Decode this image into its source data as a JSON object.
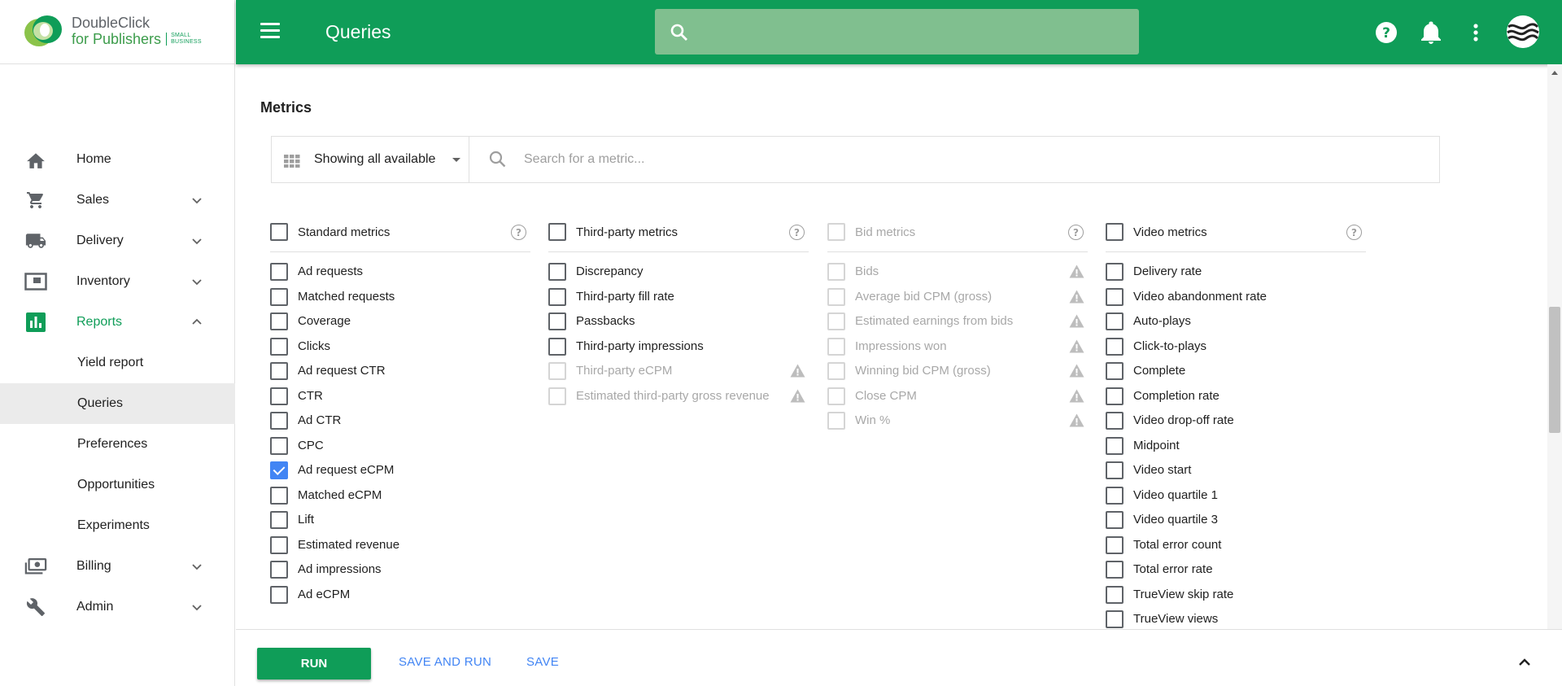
{
  "app": {
    "logo_line1": "DoubleClick",
    "logo_line2": "for Publishers",
    "logo_badge_line1": "SMALL",
    "logo_badge_line2": "BUSINESS",
    "brand_color": "#0f9d58"
  },
  "header": {
    "title": "Queries",
    "search_placeholder": "",
    "icons": [
      "menu-icon",
      "search-icon",
      "help-icon",
      "notifications-icon",
      "more-vert-icon",
      "avatar"
    ]
  },
  "sidebar": {
    "items": [
      {
        "label": "Home",
        "icon": "home-icon"
      },
      {
        "label": "Sales",
        "icon": "cart-icon",
        "expandable": true
      },
      {
        "label": "Delivery",
        "icon": "truck-icon",
        "expandable": true
      },
      {
        "label": "Inventory",
        "icon": "inventory-icon",
        "expandable": true
      },
      {
        "label": "Reports",
        "icon": "bar-chart-icon",
        "expanded": true,
        "active": true
      },
      {
        "label": "Billing",
        "icon": "money-icon",
        "expandable": true
      },
      {
        "label": "Admin",
        "icon": "wrench-icon",
        "expandable": true
      }
    ],
    "reports_sub": [
      {
        "label": "Yield report"
      },
      {
        "label": "Queries",
        "selected": true
      },
      {
        "label": "Preferences"
      },
      {
        "label": "Opportunities"
      },
      {
        "label": "Experiments"
      }
    ]
  },
  "metrics": {
    "title": "Metrics",
    "filter_label": "Showing all available",
    "search_placeholder": "Search for a metric...",
    "columns": [
      {
        "heading": "Standard metrics",
        "disabled": false,
        "items": [
          {
            "label": "Ad requests",
            "checked": false
          },
          {
            "label": "Matched requests",
            "checked": false
          },
          {
            "label": "Coverage",
            "checked": false
          },
          {
            "label": "Clicks",
            "checked": false
          },
          {
            "label": "Ad request CTR",
            "checked": false
          },
          {
            "label": "CTR",
            "checked": false
          },
          {
            "label": "Ad CTR",
            "checked": false
          },
          {
            "label": "CPC",
            "checked": false
          },
          {
            "label": "Ad request eCPM",
            "checked": true
          },
          {
            "label": "Matched eCPM",
            "checked": false
          },
          {
            "label": "Lift",
            "checked": false
          },
          {
            "label": "Estimated revenue",
            "checked": false
          },
          {
            "label": "Ad impressions",
            "checked": false
          },
          {
            "label": "Ad eCPM",
            "checked": false
          }
        ]
      },
      {
        "heading": "Third-party metrics",
        "disabled": false,
        "items": [
          {
            "label": "Discrepancy",
            "checked": false
          },
          {
            "label": "Third-party fill rate",
            "checked": false
          },
          {
            "label": "Passbacks",
            "checked": false
          },
          {
            "label": "Third-party impressions",
            "checked": false
          },
          {
            "label": "Third-party eCPM",
            "checked": false,
            "disabled": true,
            "warning": true
          },
          {
            "label": "Estimated third-party gross revenue",
            "checked": false,
            "disabled": true,
            "warning": true
          }
        ]
      },
      {
        "heading": "Bid metrics",
        "disabled": true,
        "items": [
          {
            "label": "Bids",
            "disabled": true,
            "warning": true
          },
          {
            "label": "Average bid CPM (gross)",
            "disabled": true,
            "warning": true
          },
          {
            "label": "Estimated earnings from bids",
            "disabled": true,
            "warning": true
          },
          {
            "label": "Impressions won",
            "disabled": true,
            "warning": true
          },
          {
            "label": "Winning bid CPM (gross)",
            "disabled": true,
            "warning": true
          },
          {
            "label": "Close CPM",
            "disabled": true,
            "warning": true
          },
          {
            "label": "Win %",
            "disabled": true,
            "warning": true
          }
        ]
      },
      {
        "heading": "Video metrics",
        "disabled": false,
        "items": [
          {
            "label": "Delivery rate",
            "checked": false
          },
          {
            "label": "Video abandonment rate",
            "checked": false
          },
          {
            "label": "Auto-plays",
            "checked": false
          },
          {
            "label": "Click-to-plays",
            "checked": false
          },
          {
            "label": "Complete",
            "checked": false
          },
          {
            "label": "Completion rate",
            "checked": false
          },
          {
            "label": "Video drop-off rate",
            "checked": false
          },
          {
            "label": "Midpoint",
            "checked": false
          },
          {
            "label": "Video start",
            "checked": false
          },
          {
            "label": "Video quartile 1",
            "checked": false
          },
          {
            "label": "Video quartile 3",
            "checked": false
          },
          {
            "label": "Total error count",
            "checked": false
          },
          {
            "label": "Total error rate",
            "checked": false
          },
          {
            "label": "TrueView skip rate",
            "checked": false
          },
          {
            "label": "TrueView views",
            "checked": false
          }
        ]
      }
    ]
  },
  "footer": {
    "run_label": "RUN",
    "save_and_run_label": "SAVE AND RUN",
    "save_label": "SAVE"
  }
}
